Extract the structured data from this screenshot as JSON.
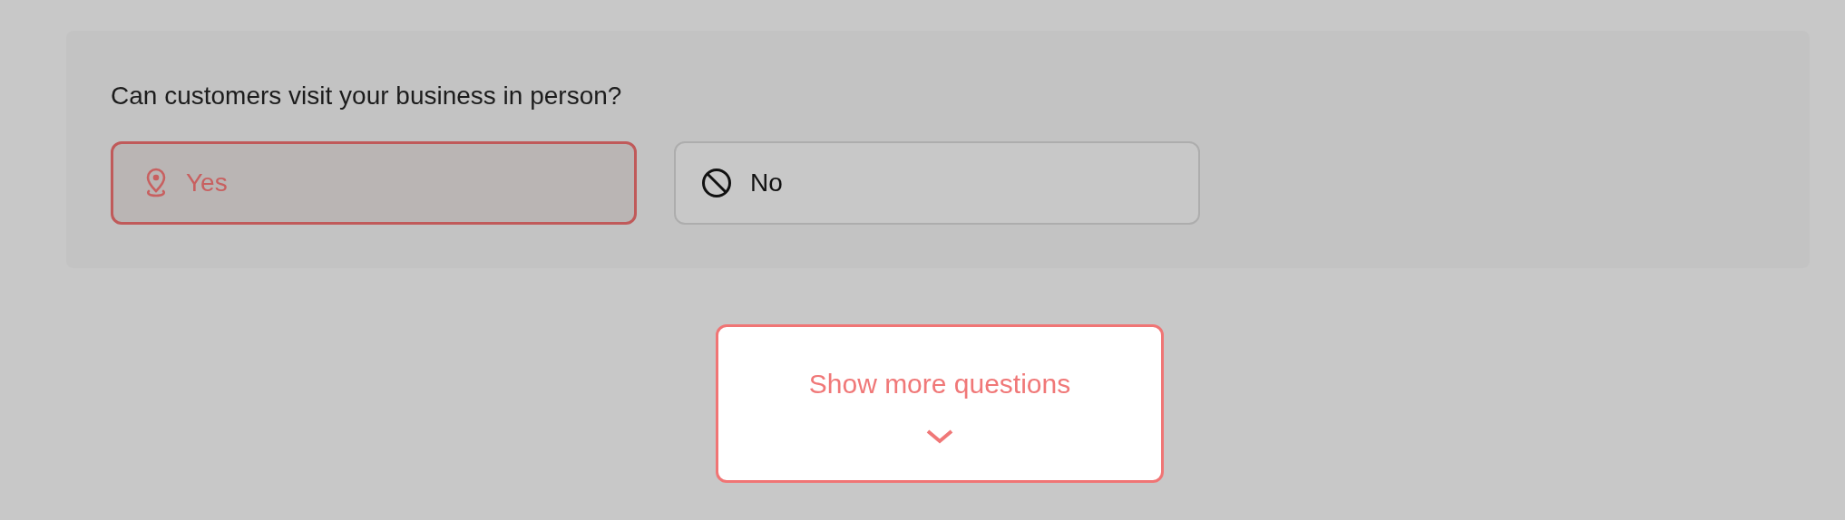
{
  "question": {
    "text": "Can customers visit your business in person?",
    "options": [
      {
        "label": "Yes",
        "kind": "location",
        "selected": true
      },
      {
        "label": "No",
        "kind": "none",
        "selected": false
      }
    ]
  },
  "show_more": {
    "label": "Show more questions"
  }
}
